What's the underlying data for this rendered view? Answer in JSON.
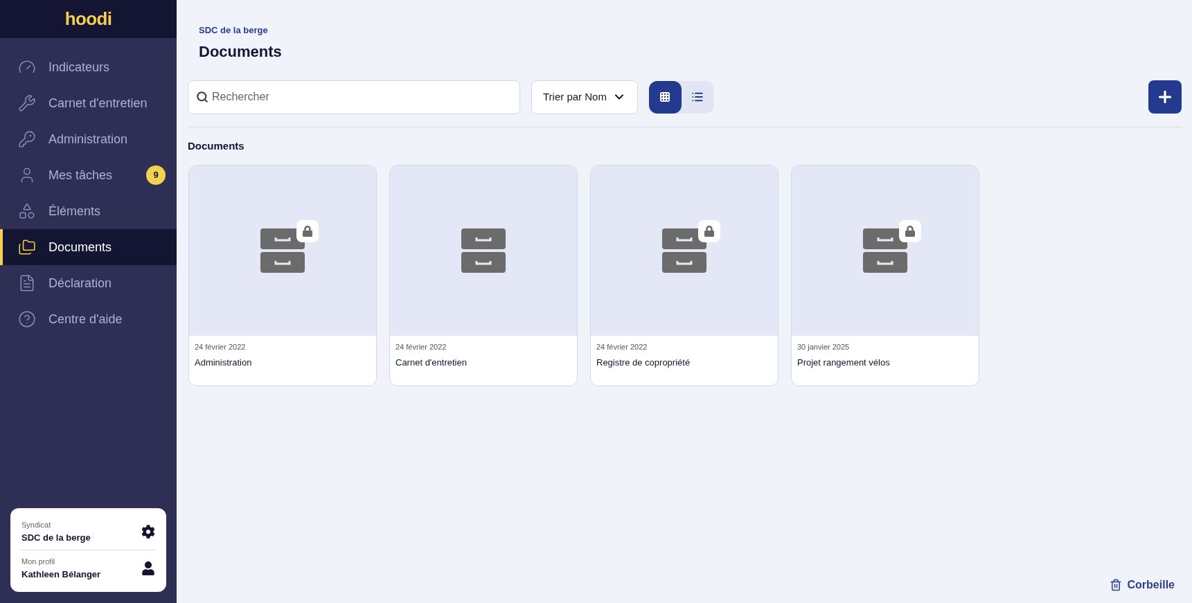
{
  "logo": "hoodi",
  "nav": [
    {
      "label": "Indicateurs",
      "selected": false
    },
    {
      "label": "Carnet d'entretien",
      "selected": false
    },
    {
      "label": "Administration",
      "selected": false
    },
    {
      "label": "Mes tâches",
      "selected": false,
      "badge": "9"
    },
    {
      "label": "Éléments",
      "selected": false
    },
    {
      "label": "Documents",
      "selected": true
    },
    {
      "label": "Déclaration",
      "selected": false
    },
    {
      "label": "Centre d'aide",
      "selected": false
    }
  ],
  "account": [
    {
      "caption": "Syndicat",
      "name": "SDC de la berge"
    },
    {
      "caption": "Mon profil",
      "name": "Kathleen Bélanger"
    }
  ],
  "breadcrumb": "SDC de la berge",
  "title": "Documents",
  "search": {
    "placeholder": "Rechercher"
  },
  "sort": {
    "label": "Trier par Nom"
  },
  "views": [
    {
      "selected": true
    },
    {
      "selected": false
    }
  ],
  "section_title": "Documents",
  "folders": [
    {
      "date": "24 février 2022",
      "name": "Administration",
      "locked": true
    },
    {
      "date": "24 février 2022",
      "name": "Carnet d'entretien",
      "locked": false
    },
    {
      "date": "24 février 2022",
      "name": "Registre de copropriété",
      "locked": true
    },
    {
      "date": "30 janvier 2025",
      "name": "Projet rangement vélos",
      "locked": true
    }
  ],
  "trash": {
    "label": "Corbeille"
  }
}
